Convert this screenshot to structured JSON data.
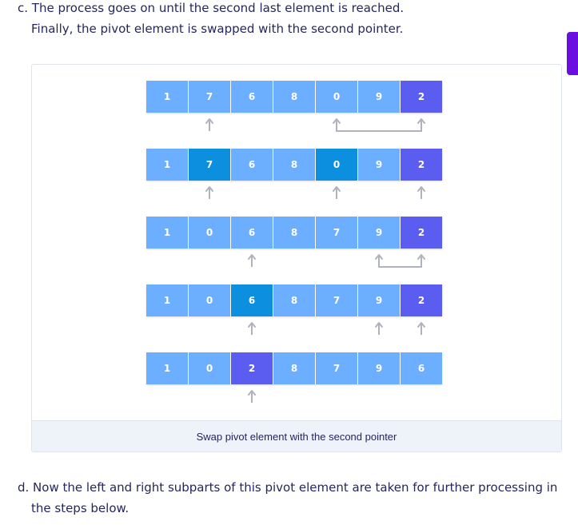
{
  "text": {
    "step_c_line1": "c. The process goes on until the second last element is reached.",
    "step_c_line2": "Finally, the pivot element is swapped with the second pointer.",
    "step_d_line1": "d. Now the left and right subparts of this pivot element are taken for further processing in",
    "step_d_line2": "the steps below."
  },
  "figure": {
    "caption": "Swap pivot element with the second pointer",
    "rows": [
      {
        "values": [
          "1",
          "7",
          "6",
          "8",
          "0",
          "9",
          "2"
        ],
        "highlight": {
          "6": "pivot"
        }
      },
      {
        "values": [
          "1",
          "7",
          "6",
          "8",
          "0",
          "9",
          "2"
        ],
        "highlight": {
          "1": "compare",
          "4": "compare",
          "6": "pivot"
        }
      },
      {
        "values": [
          "1",
          "0",
          "6",
          "8",
          "7",
          "9",
          "2"
        ],
        "highlight": {
          "6": "pivot"
        }
      },
      {
        "values": [
          "1",
          "0",
          "6",
          "8",
          "7",
          "9",
          "2"
        ],
        "highlight": {
          "2": "compare",
          "6": "pivot"
        }
      },
      {
        "values": [
          "1",
          "0",
          "2",
          "8",
          "7",
          "9",
          "6"
        ],
        "highlight": {
          "2": "pivot"
        }
      }
    ],
    "arrows": [
      {
        "row": 0,
        "single": [
          1
        ],
        "bracket": [
          4,
          6
        ]
      },
      {
        "row": 1,
        "single": [
          1,
          4,
          6
        ],
        "bracket": null
      },
      {
        "row": 2,
        "single": [
          2
        ],
        "bracket": [
          5,
          6
        ]
      },
      {
        "row": 3,
        "single": [
          2,
          5,
          6
        ],
        "bracket": null
      },
      {
        "row": 4,
        "single": [
          2
        ],
        "bracket": null
      }
    ]
  },
  "colors": {
    "cell": "#6caeff",
    "compare": "#0d8fe0",
    "pivot": "#5b5cf0",
    "arrow": "#b0b3bd",
    "accent_tab": "#6a0fe0"
  }
}
